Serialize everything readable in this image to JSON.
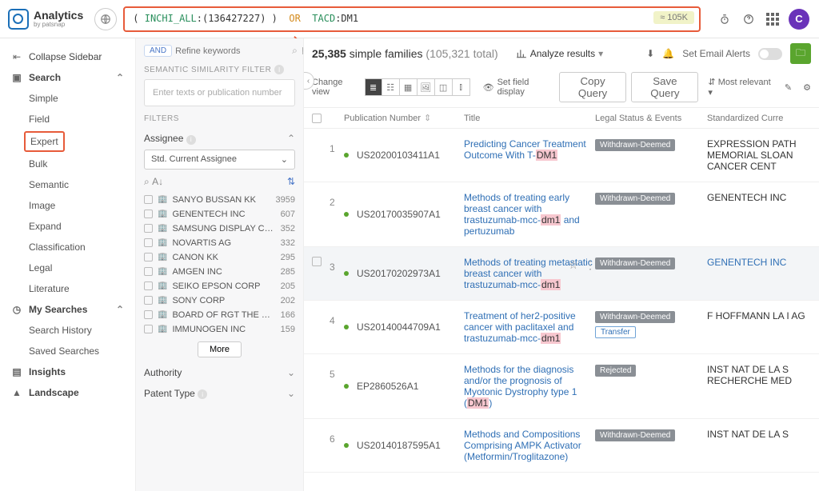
{
  "brand": {
    "name": "Analytics",
    "sub": "by patsnap"
  },
  "query": {
    "paren_open": "(",
    "field1": "INCHI_ALL",
    "val1": ":(136427227) )",
    "op": "OR",
    "field2": "TACD",
    "val2": ":DM1",
    "approx_count": "≈ 105K"
  },
  "sidebar": {
    "collapse": "Collapse Sidebar",
    "search": "Search",
    "children": [
      "Simple",
      "Field",
      "Expert",
      "Bulk",
      "Semantic",
      "Image",
      "Expand",
      "Classification",
      "Legal",
      "Literature"
    ],
    "my_searches": "My Searches",
    "ms_children": [
      "Search History",
      "Saved Searches"
    ],
    "insights": "Insights",
    "landscape": "Landscape"
  },
  "filters": {
    "and": "AND",
    "refine_ph": "Refine keywords",
    "semantic_title": "SEMANTIC SIMILARITY FILTER",
    "enter_ph": "Enter texts or publication number",
    "filters_label": "FILTERS",
    "assignee": "Assignee",
    "std_current": "Std. Current Assignee",
    "more": "More",
    "authority": "Authority",
    "patent_type": "Patent Type",
    "items": [
      {
        "name": "SANYO BUSSAN KK",
        "count": "3959"
      },
      {
        "name": "GENENTECH INC",
        "count": "607"
      },
      {
        "name": "SAMSUNG DISPLAY CO LTD",
        "count": "352"
      },
      {
        "name": "NOVARTIS AG",
        "count": "332"
      },
      {
        "name": "CANON KK",
        "count": "295"
      },
      {
        "name": "AMGEN INC",
        "count": "285"
      },
      {
        "name": "SEIKO EPSON CORP",
        "count": "205"
      },
      {
        "name": "SONY CORP",
        "count": "202"
      },
      {
        "name": "BOARD OF RGT THE UNIV OF TEXAS SYST",
        "count": "166"
      },
      {
        "name": "IMMUNOGEN INC",
        "count": "159"
      }
    ]
  },
  "results": {
    "count_main": "25,385",
    "count_label": "simple families",
    "count_total": "(105,321 total)",
    "analyze": "Analyze results",
    "set_email": "Set Email Alerts",
    "change_view": "Change view",
    "set_field": "Set field display",
    "copy_query": "Copy Query",
    "save_query": "Save Query",
    "sort": "Most relevant",
    "headers": {
      "pub": "Publication Number",
      "title": "Title",
      "legal": "Legal Status & Events",
      "assignee": "Standardized Curre"
    },
    "rows": [
      {
        "idx": "1",
        "pub": "US20200103411A1",
        "title_pre": "Predicting Cancer Treatment Outcome With T-",
        "title_hl": "DM1",
        "title_post": "",
        "legal": "Withdrawn-Deemed",
        "asg": "EXPRESSION PATH MEMORIAL SLOAN CANCER CENT"
      },
      {
        "idx": "2",
        "pub": "US20170035907A1",
        "title_pre": "Methods of treating early breast cancer with trastuzumab-mcc-",
        "title_hl": "dm1",
        "title_post": " and pertuzumab",
        "legal": "Withdrawn-Deemed",
        "asg": "GENENTECH INC"
      },
      {
        "idx": "3",
        "pub": "US20170202973A1",
        "title_pre": "Methods of treating metastatic breast cancer with trastuzumab-mcc-",
        "title_hl": "dm1",
        "title_post": "",
        "legal": "Withdrawn-Deemed",
        "asg": "GENENTECH INC",
        "hov": true,
        "asg_blue": true
      },
      {
        "idx": "4",
        "pub": "US20140044709A1",
        "title_pre": "Treatment of her2-positive cancer with paclitaxel and trastuzumab-mcc-",
        "title_hl": "dm1",
        "title_post": "",
        "legal": "Withdrawn-Deemed",
        "legal_sub": "Transfer",
        "asg": "F HOFFMANN LA I AG"
      },
      {
        "idx": "5",
        "pub": "EP2860526A1",
        "title_pre": "Methods for the diagnosis and/or the prognosis of Myotonic Dystrophy type 1 (",
        "title_hl": "DM1",
        "title_post": ")",
        "legal": "Rejected",
        "asg": "INST NAT DE LA S RECHERCHE MED"
      },
      {
        "idx": "6",
        "pub": "US20140187595A1",
        "title_pre": "Methods and Compositions Comprising AMPK Activator (Metformin/Troglitazone)",
        "title_hl": "",
        "title_post": "",
        "legal": "Withdrawn-Deemed",
        "asg": "INST NAT DE LA S"
      }
    ]
  },
  "avatar": "C"
}
